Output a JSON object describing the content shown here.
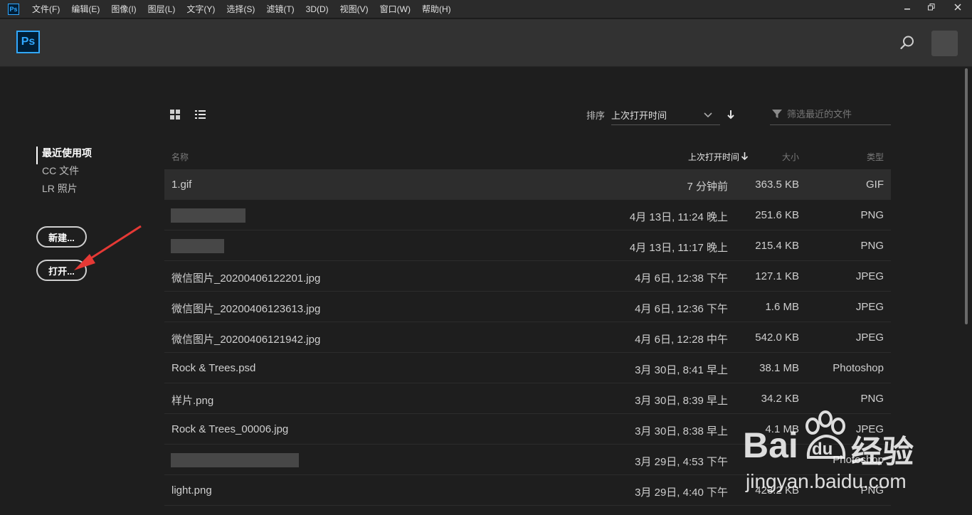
{
  "menubar": {
    "app_icon": "Ps",
    "items": [
      "文件(F)",
      "编辑(E)",
      "图像(I)",
      "图层(L)",
      "文字(Y)",
      "选择(S)",
      "滤镜(T)",
      "3D(D)",
      "视图(V)",
      "窗口(W)",
      "帮助(H)"
    ],
    "window_controls": [
      "minimize-icon",
      "restore-icon",
      "close-icon"
    ]
  },
  "header": {
    "logo": "Ps",
    "search_icon": "search-icon"
  },
  "sidebar": {
    "nav": [
      {
        "label": "最近使用项",
        "active": true
      },
      {
        "label": "CC 文件",
        "active": false
      },
      {
        "label": "LR 照片",
        "active": false
      }
    ],
    "new_label": "新建...",
    "open_label": "打开..."
  },
  "toolbar": {
    "sort_label": "排序",
    "sort_value": "上次打开时间",
    "filter_placeholder": "筛选最近的文件"
  },
  "table": {
    "headers": {
      "name": "名称",
      "time": "上次打开时间",
      "size": "大小",
      "type": "类型"
    },
    "rows": [
      {
        "name": "1.gif",
        "time": "7 分钟前",
        "size": "363.5 KB",
        "type": "GIF",
        "selected": true
      },
      {
        "name": "",
        "time": "4月 13日, 11:24 晚上",
        "size": "251.6 KB",
        "type": "PNG",
        "redacted": true
      },
      {
        "name": "",
        "time": "4月 13日, 11:17 晚上",
        "size": "215.4 KB",
        "type": "PNG",
        "redacted": true
      },
      {
        "name": "微信图片_20200406122201.jpg",
        "time": "4月 6日, 12:38 下午",
        "size": "127.1 KB",
        "type": "JPEG"
      },
      {
        "name": "微信图片_20200406123613.jpg",
        "time": "4月 6日, 12:36 下午",
        "size": "1.6 MB",
        "type": "JPEG"
      },
      {
        "name": "微信图片_20200406121942.jpg",
        "time": "4月 6日, 12:28 中午",
        "size": "542.0 KB",
        "type": "JPEG"
      },
      {
        "name": "Rock & Trees.psd",
        "time": "3月 30日, 8:41 早上",
        "size": "38.1 MB",
        "type": "Photoshop"
      },
      {
        "name": "样片.png",
        "time": "3月 30日, 8:39 早上",
        "size": "34.2 KB",
        "type": "PNG"
      },
      {
        "name": "Rock & Trees_00006.jpg",
        "time": "3月 30日, 8:38 早上",
        "size": "4.1 MB",
        "type": "JPEG"
      },
      {
        "name": "",
        "time": "3月 29日, 4:53 下午",
        "size": "",
        "type": "Photoshop",
        "redacted": true
      },
      {
        "name": "light.png",
        "time": "3月 29日, 4:40 下午",
        "size": "423.2 KB",
        "type": "PNG"
      }
    ]
  },
  "watermark": {
    "brand_left": "Bai",
    "brand_paw": "du",
    "brand_right": "经验",
    "url": "jingyan.baidu.com"
  },
  "colors": {
    "ps_blue": "#31a8ff",
    "annotation_red": "#e53935"
  }
}
